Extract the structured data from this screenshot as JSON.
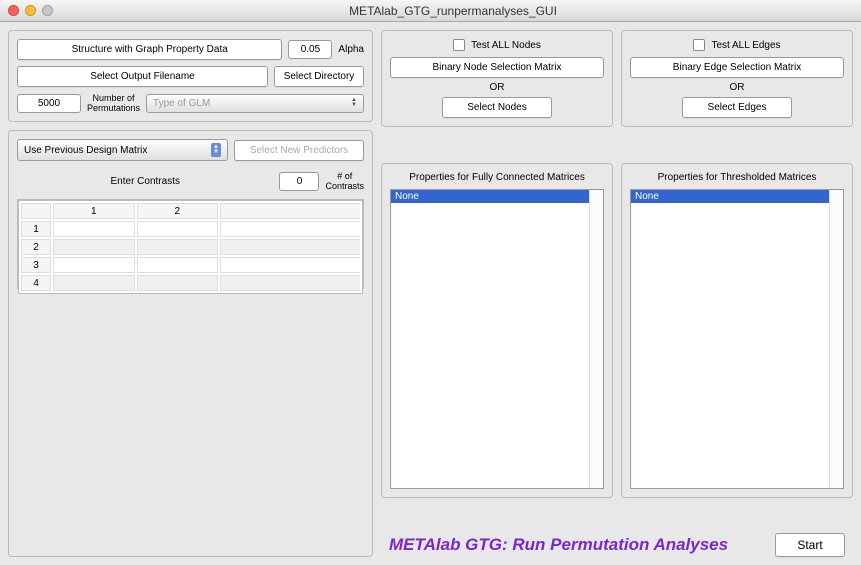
{
  "window": {
    "title": "METAlab_GTG_runpermanalyses_GUI"
  },
  "topPanel": {
    "structureBtn": "Structure with Graph Property Data",
    "alphaValue": "0.05",
    "alphaLabel": "Alpha",
    "outputBtn": "Select Output Filename",
    "selectDirBtn": "Select Directory",
    "permValue": "5000",
    "permLabel": "Number of\nPermutations",
    "glmDropdown": "Type of GLM"
  },
  "designPanel": {
    "prevMatrix": "Use Previous Design Matrix",
    "newPredictors": "Select New Predictors",
    "enterContrasts": "Enter Contrasts",
    "numContrastsVal": "0",
    "numContrastsLabel": "# of\nContrasts",
    "cols": [
      "1",
      "2"
    ],
    "rows": [
      "1",
      "2",
      "3",
      "4"
    ]
  },
  "nodes": {
    "testAll": "Test ALL Nodes",
    "matrixBtn": "Binary Node Selection Matrix",
    "or": "OR",
    "selectBtn": "Select Nodes"
  },
  "edges": {
    "testAll": "Test ALL Edges",
    "matrixBtn": "Binary Edge Selection Matrix",
    "or": "OR",
    "selectBtn": "Select Edges"
  },
  "propsFull": {
    "title": "Properties for Fully Connected Matrices",
    "item": "None"
  },
  "propsThresh": {
    "title": "Properties for Thresholded Matrices",
    "item": "None"
  },
  "footer": {
    "brand": "METAlab GTG: Run Permutation Analyses",
    "start": "Start"
  }
}
